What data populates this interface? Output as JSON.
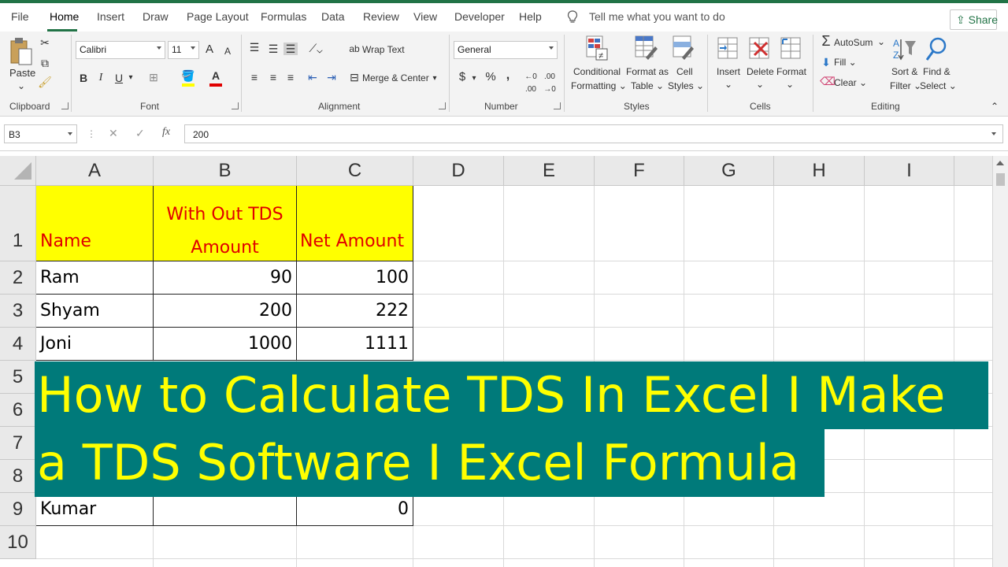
{
  "tabs": [
    "File",
    "Home",
    "Insert",
    "Draw",
    "Page Layout",
    "Formulas",
    "Data",
    "Review",
    "View",
    "Developer",
    "Help"
  ],
  "active_tab": "Home",
  "tell_me": "Tell me what you want to do",
  "share": "Share",
  "ribbon": {
    "clipboard": {
      "paste": "Paste",
      "label": "Clipboard"
    },
    "font": {
      "name": "Calibri",
      "size": "11",
      "bold": "B",
      "italic": "I",
      "underline": "U",
      "grow": "A",
      "shrink": "A",
      "label": "Font"
    },
    "alignment": {
      "wrap_text": "Wrap Text",
      "merge_center": "Merge & Center",
      "label": "Alignment"
    },
    "number": {
      "format": "General",
      "currency": "$",
      "percent": "%",
      "comma": ",",
      "label": "Number"
    },
    "styles": {
      "conditional_1": "Conditional",
      "conditional_2": "Formatting",
      "format_table_1": "Format as",
      "format_table_2": "Table",
      "cell_styles_1": "Cell",
      "cell_styles_2": "Styles",
      "label": "Styles"
    },
    "cells": {
      "insert": "Insert",
      "delete": "Delete",
      "format": "Format",
      "label": "Cells"
    },
    "editing": {
      "autosum": "AutoSum",
      "fill": "Fill",
      "clear": "Clear",
      "sort_1": "Sort &",
      "sort_2": "Filter",
      "find_1": "Find &",
      "find_2": "Select",
      "label": "Editing"
    }
  },
  "formula_bar": {
    "name_box": "B3",
    "fx": "fx",
    "value": "200"
  },
  "columns": [
    "A",
    "B",
    "C",
    "D",
    "E",
    "F",
    "G",
    "H",
    "I"
  ],
  "rows": [
    "1",
    "2",
    "3",
    "4",
    "5",
    "6",
    "7",
    "8",
    "9",
    "10"
  ],
  "sheet": {
    "header": {
      "a": "Name",
      "b_line1": "With Out TDS",
      "b_line2": "Amount",
      "c": "Net Amount"
    },
    "r2": {
      "a": "Ram",
      "b": "90",
      "c": "100"
    },
    "r3": {
      "a": "Shyam",
      "b": "200",
      "c": "222"
    },
    "r4": {
      "a": "Joni",
      "b": "1000",
      "c": "1111"
    },
    "r9": {
      "a": "Kumar",
      "b": "",
      "c": "0"
    }
  },
  "overlay": {
    "line1": "How to Calculate TDS In Excel I Make",
    "line2": "a TDS Software I Excel Formula"
  },
  "colors": {
    "accent": "#217346",
    "header_fill": "#ffff00",
    "header_text": "#e00000",
    "overlay_bg": "#007a7a",
    "overlay_text": "#ffff00"
  }
}
